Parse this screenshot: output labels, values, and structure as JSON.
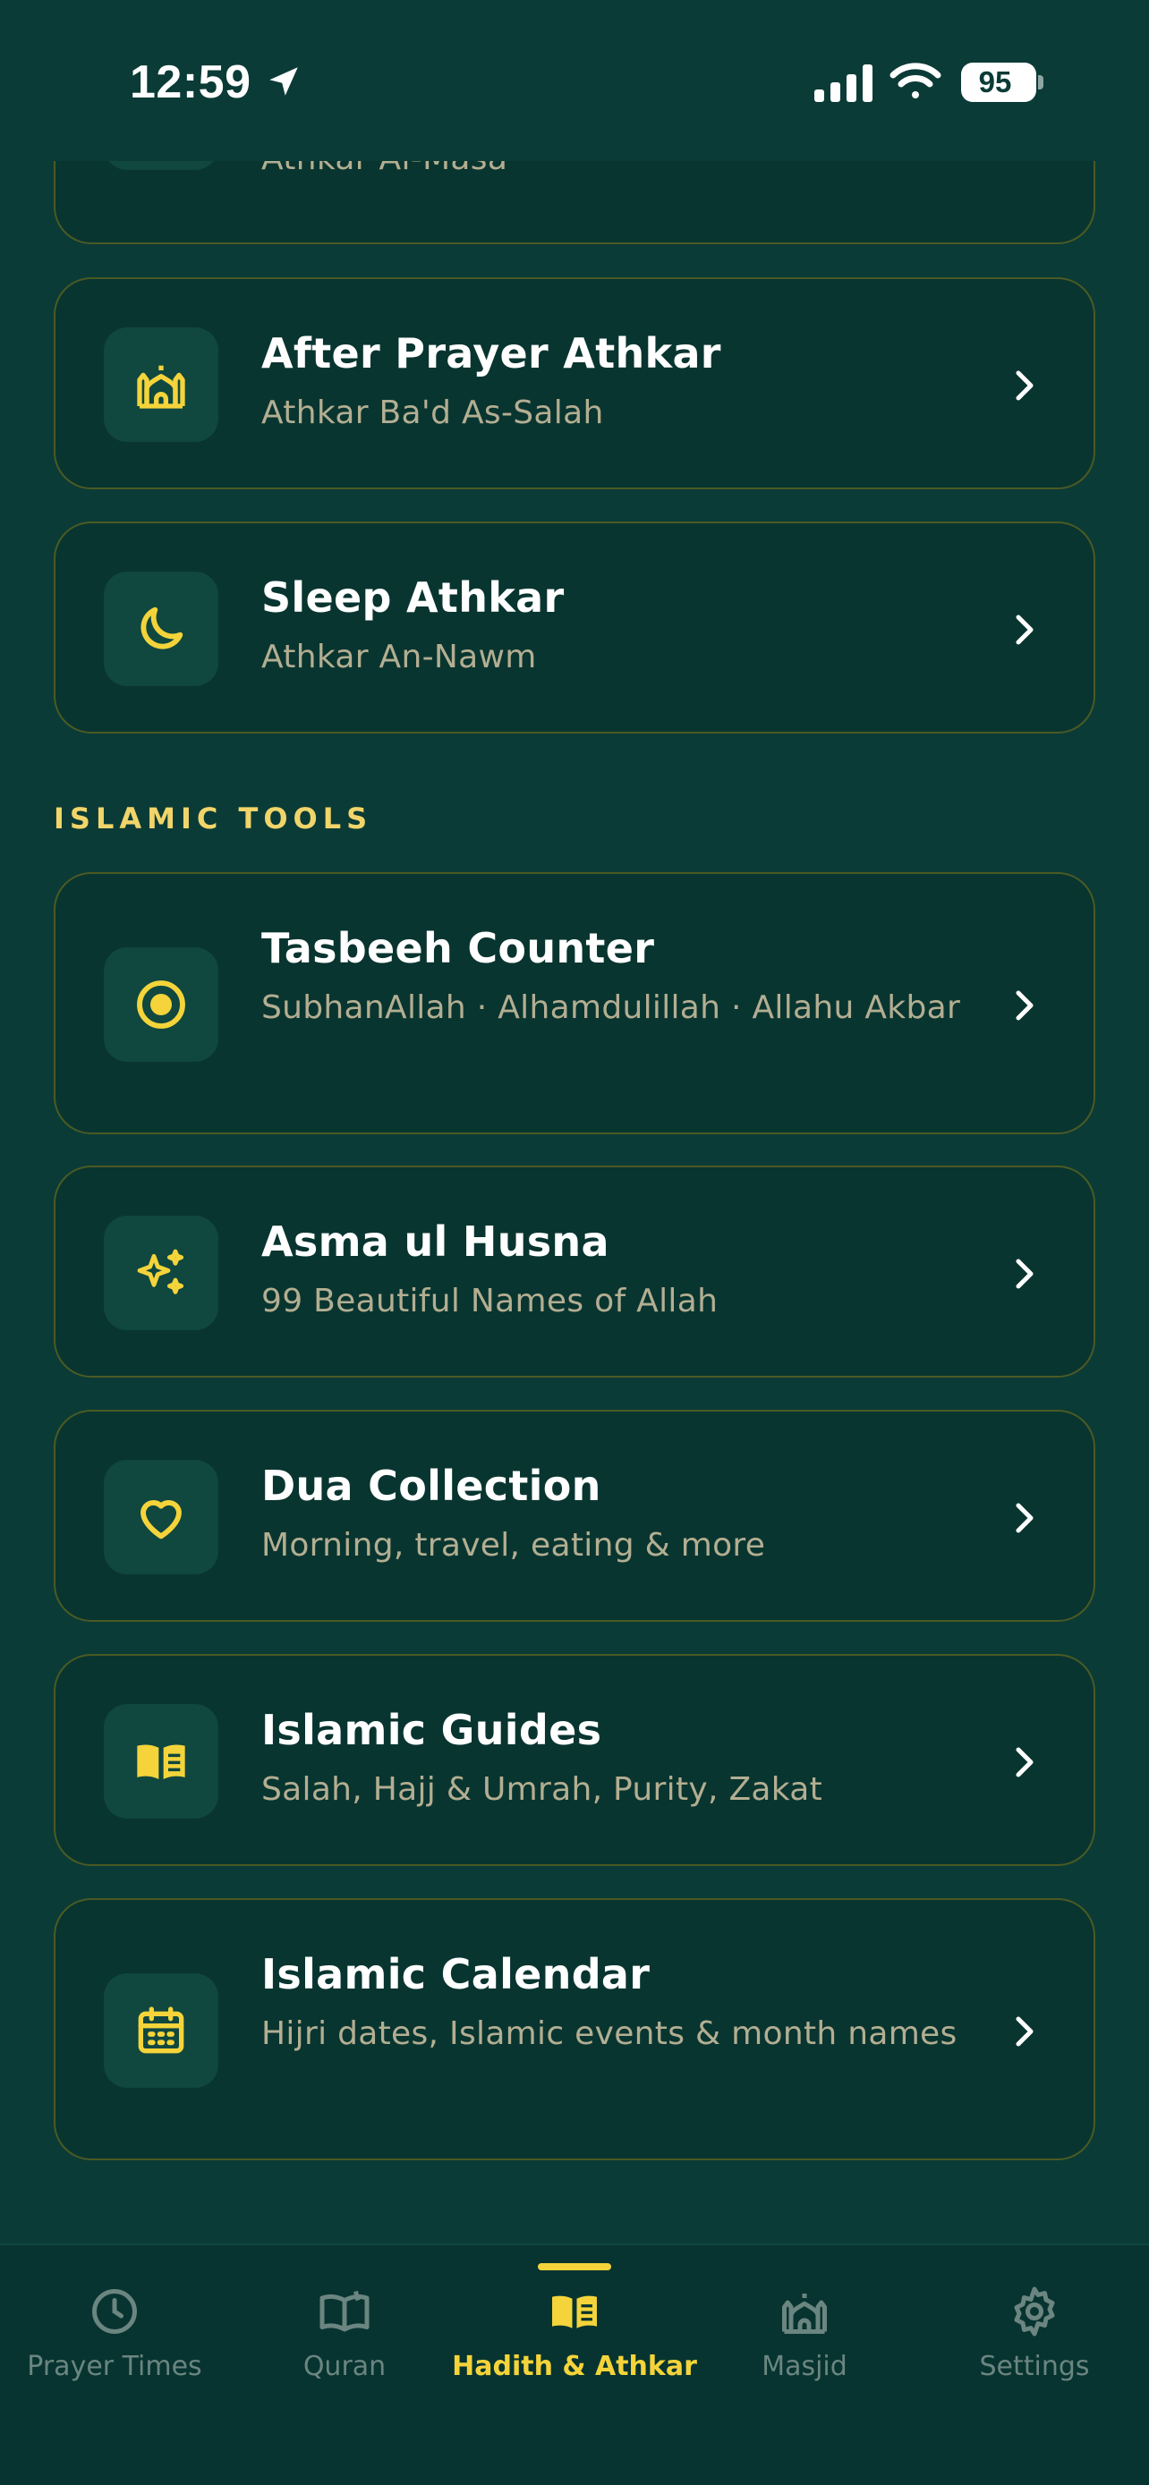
{
  "status_bar": {
    "time": "12:59",
    "battery": "95"
  },
  "cards_top": [
    {
      "title": "",
      "subtitle": "Athkar Al-Masa",
      "icon": "sun-icon"
    },
    {
      "title": "After Prayer Athkar",
      "subtitle": "Athkar Ba'd As-Salah",
      "icon": "mosque-icon"
    },
    {
      "title": "Sleep Athkar",
      "subtitle": "Athkar An-Nawm",
      "icon": "moon-icon"
    }
  ],
  "section": {
    "label": "ISLAMIC TOOLS"
  },
  "tools": [
    {
      "title": "Tasbeeh Counter",
      "subtitle": "SubhanAllah · Alhamdulillah · Allahu Akbar",
      "icon": "target-icon"
    },
    {
      "title": "Asma ul Husna",
      "subtitle": "99 Beautiful Names of Allah",
      "icon": "sparkles-icon"
    },
    {
      "title": "Dua Collection",
      "subtitle": "Morning, travel, eating & more",
      "icon": "heart-icon"
    },
    {
      "title": "Islamic Guides",
      "subtitle": "Salah, Hajj & Umrah, Purity, Zakat",
      "icon": "book-icon"
    },
    {
      "title": "Islamic Calendar",
      "subtitle": "Hijri dates, Islamic events & month names",
      "icon": "calendar-icon"
    }
  ],
  "tab_bar": {
    "active": "Hadith & Athkar",
    "tabs": [
      {
        "label": "Prayer Times",
        "icon": "clock-icon"
      },
      {
        "label": "Quran",
        "icon": "open-book-icon"
      },
      {
        "label": "Hadith & Athkar",
        "icon": "book-icon"
      },
      {
        "label": "Masjid",
        "icon": "mosque-icon"
      },
      {
        "label": "Settings",
        "icon": "gear-icon"
      }
    ]
  },
  "colors": {
    "background": "#0b3b36",
    "card": "#093530",
    "card_border": "#4b5a24",
    "accent": "#f4d43a",
    "subtitle": "#b3ae92",
    "tab_inactive": "#6b8580"
  }
}
